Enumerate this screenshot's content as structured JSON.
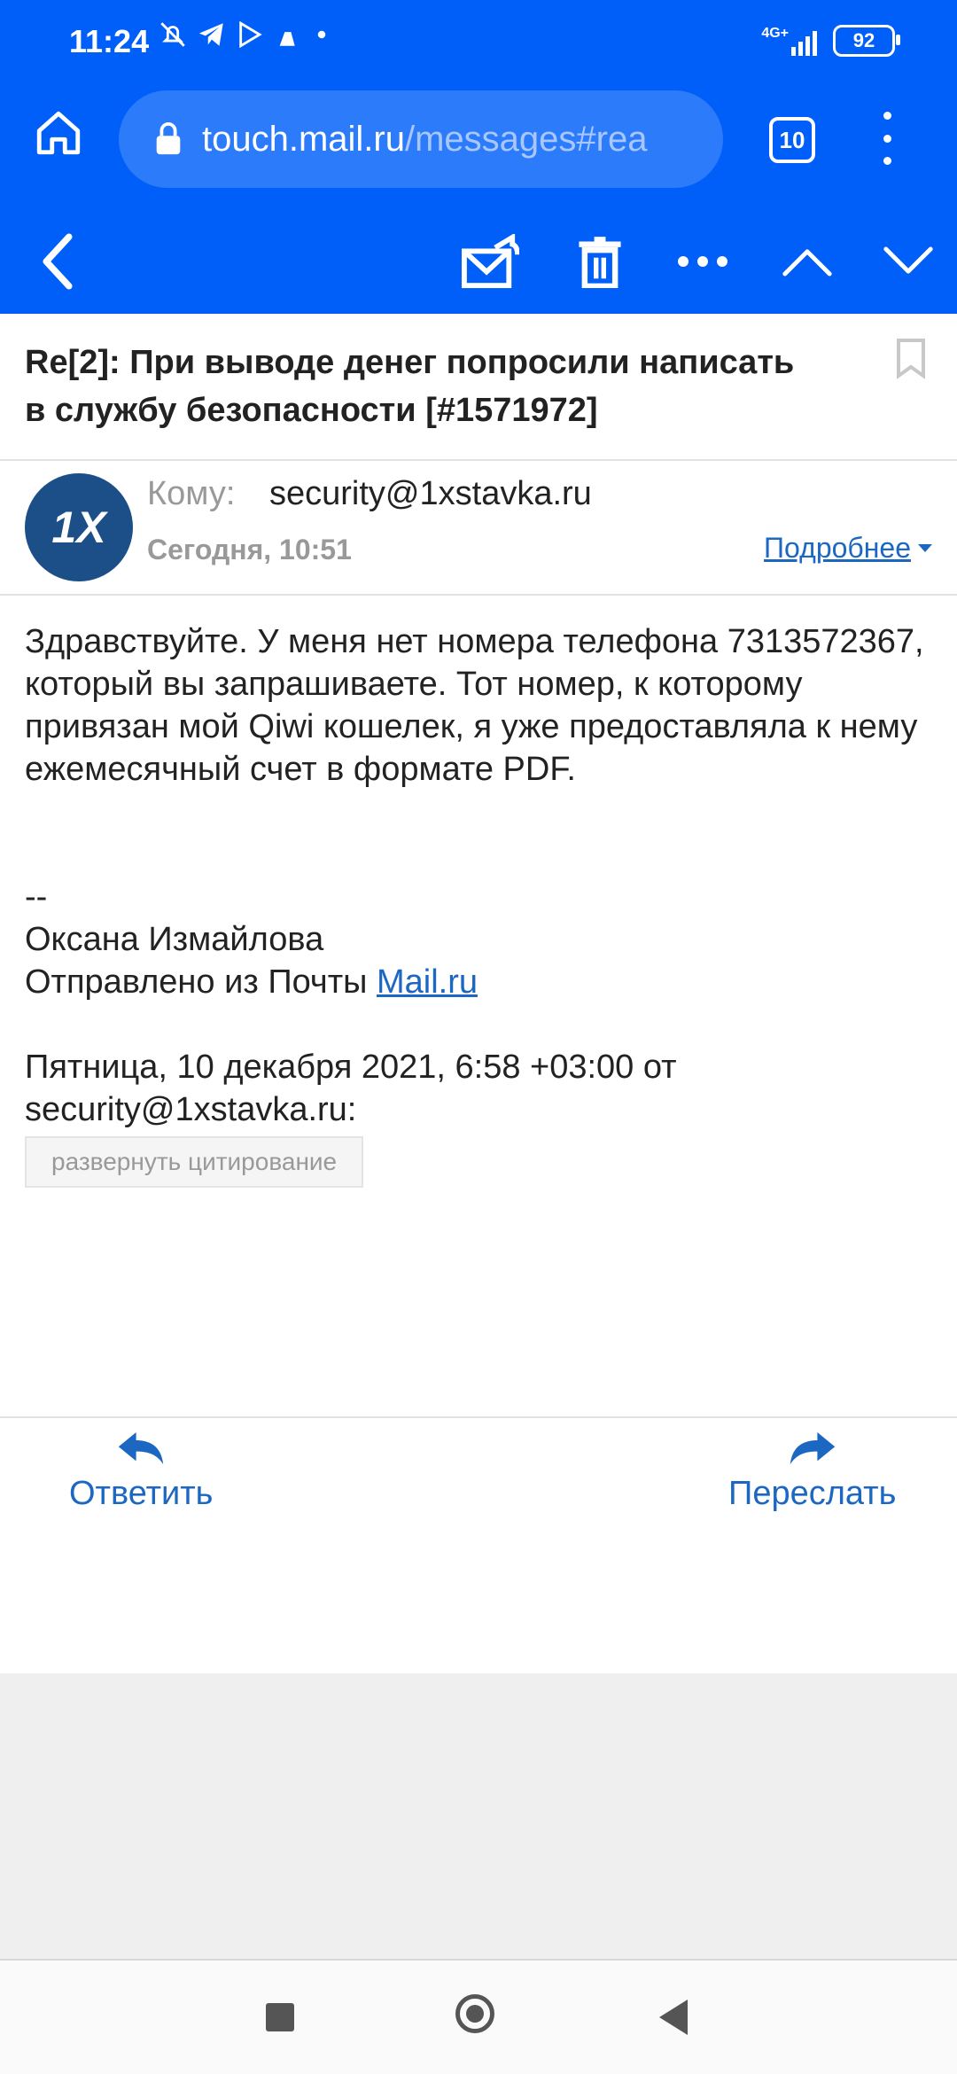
{
  "status": {
    "time": "11:24",
    "network": "4G+",
    "battery": "92"
  },
  "browser": {
    "url_host": "touch.mail.ru",
    "url_path": "/messages#rea",
    "tabs_count": "10"
  },
  "email": {
    "subject": "Re[2]: При выводе денег попросили написать в службу безопасности [#1571972]",
    "avatar_text": "1X",
    "to_label": "Кому:",
    "to_email": "security@1xstavka.ru",
    "date": "Сегодня, 10:51",
    "details_label": "Подробнее",
    "body_text": "Здравствуйте. У меня нет номера телефона 7313572367, который вы запрашиваете.  Тот номер, к которому привязан мой Qiwi кошелек, я уже предоставляла к нему ежемесячный счет в формате PDF.",
    "sig_separator": "--",
    "sig_name": "Оксана Измайлова",
    "sig_sent_prefix": "Отправлено из Почты ",
    "sig_sent_link": "Mail.ru",
    "quote_header": "Пятница, 10 декабря 2021, 6:58 +03:00 от security@1xstavka.ru:",
    "expand_quote_label": "развернуть цитирование"
  },
  "actions": {
    "reply_label": "Ответить",
    "forward_label": "Переслать"
  },
  "colors": {
    "brand_blue": "#005ff9",
    "link_blue": "#1b67c2"
  }
}
